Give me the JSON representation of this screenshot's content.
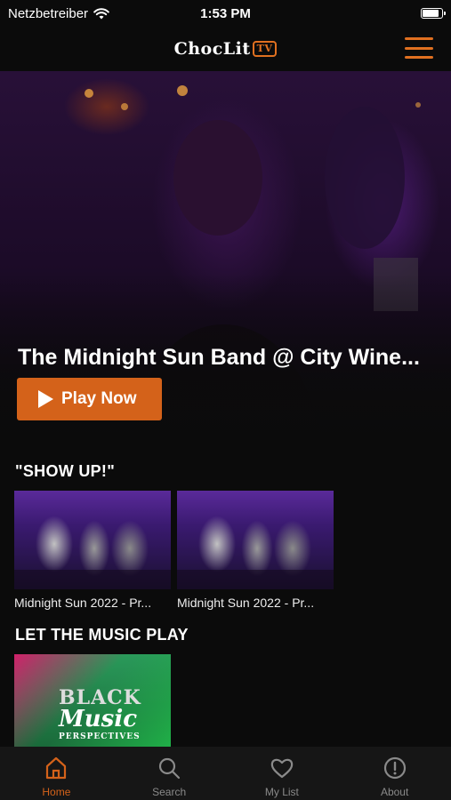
{
  "status": {
    "carrier": "Netzbetreiber",
    "time": "1:53 PM"
  },
  "header": {
    "logo_text": "ChocLit",
    "logo_badge": "TV"
  },
  "hero": {
    "title": "The Midnight Sun Band @ City Wine...",
    "play_label": "Play Now"
  },
  "sections": [
    {
      "title": "\"SHOW UP!\"",
      "items": [
        {
          "title": "Midnight Sun 2022 - Pr..."
        },
        {
          "title": "Midnight Sun 2022 - Pr..."
        }
      ]
    },
    {
      "title": "LET THE MUSIC PLAY",
      "items": [
        {
          "art_text_1": "BLACK",
          "art_text_2": "Music",
          "art_text_3": "PERSPECTIVES"
        }
      ]
    }
  ],
  "tabs": [
    {
      "label": "Home",
      "icon": "home-icon",
      "active": true
    },
    {
      "label": "Search",
      "icon": "search-icon",
      "active": false
    },
    {
      "label": "My List",
      "icon": "heart-icon",
      "active": false
    },
    {
      "label": "About",
      "icon": "info-icon",
      "active": false
    }
  ],
  "colors": {
    "accent": "#d4621a",
    "background": "#0b0b0b",
    "tab_inactive": "#8a8a8a"
  }
}
